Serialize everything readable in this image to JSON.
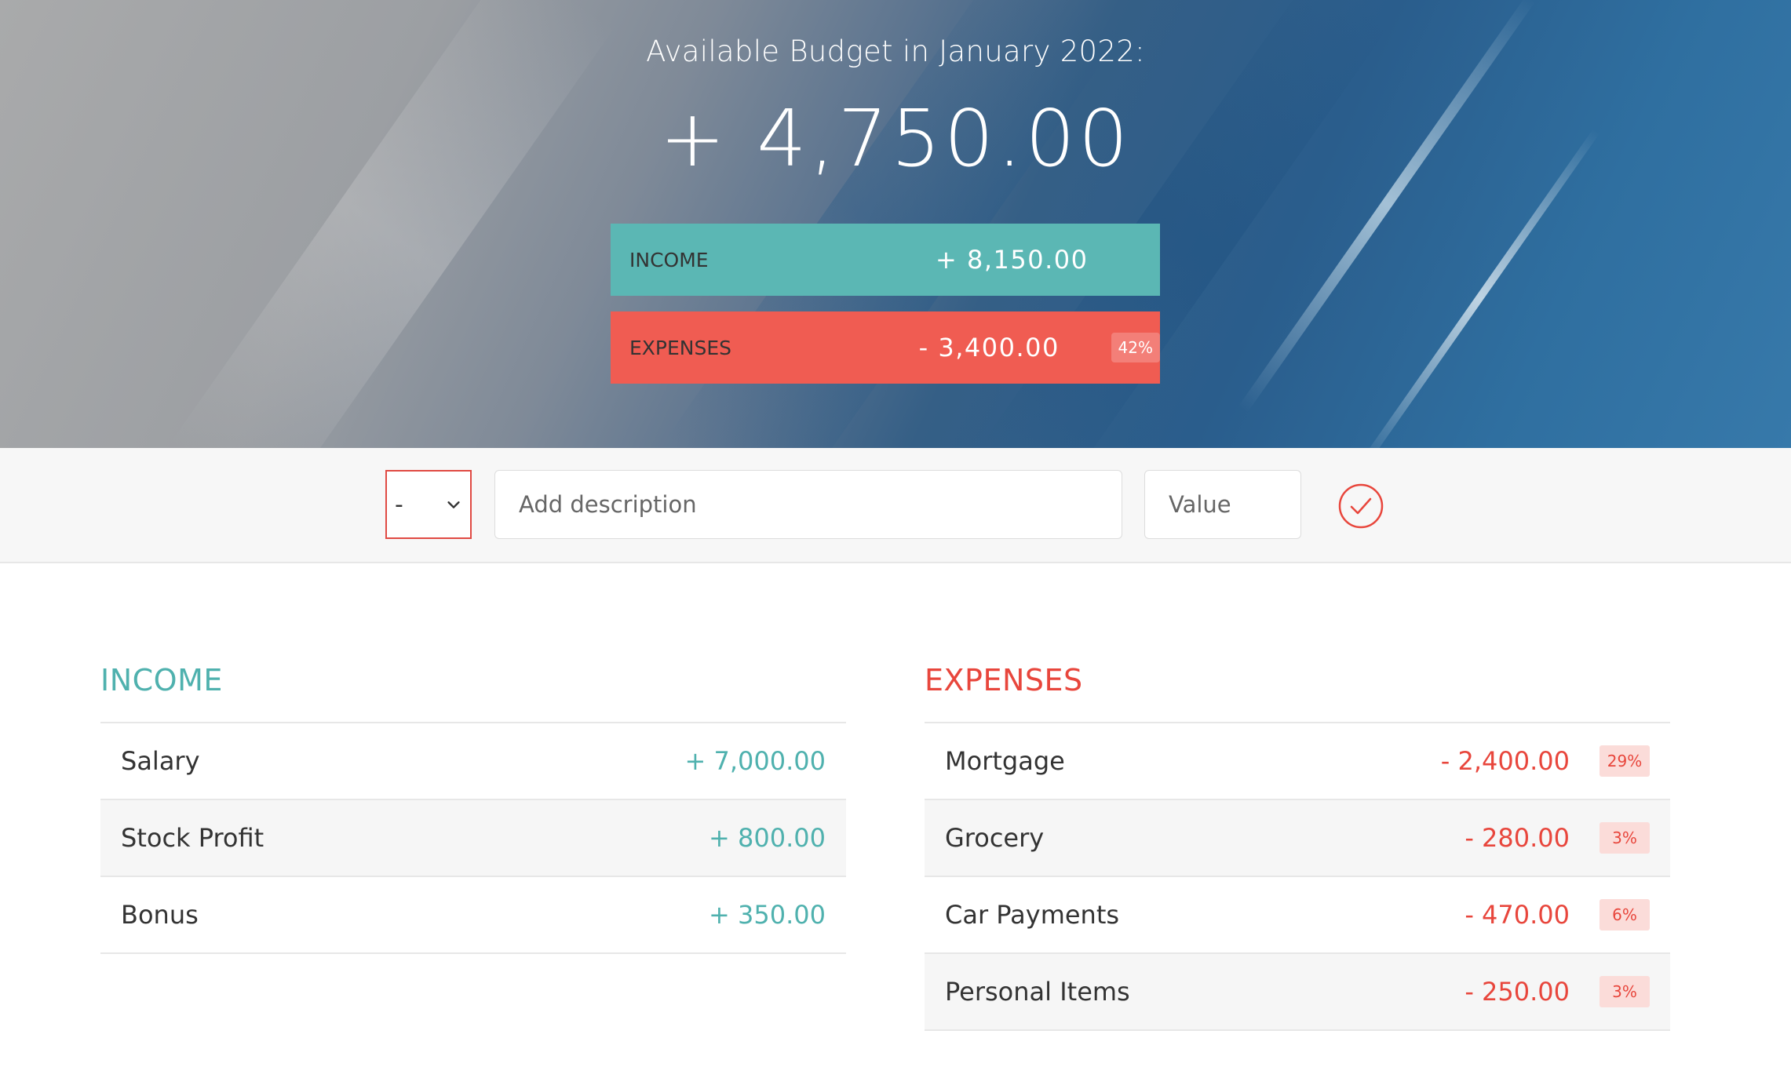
{
  "header": {
    "title": "Available Budget in January 2022:",
    "budget": "+ 4,750.00",
    "income_label": "INCOME",
    "income_value": "+ 8,150.00",
    "expenses_label": "EXPENSES",
    "expenses_value": "- 3,400.00",
    "expenses_percentage": "42%"
  },
  "add_form": {
    "type_selected": "-",
    "description_placeholder": "Add description",
    "value_placeholder": "Value",
    "submit_icon": "checkmark-circle-icon"
  },
  "income": {
    "title": "INCOME",
    "items": [
      {
        "description": "Salary",
        "value": "+ 7,000.00"
      },
      {
        "description": "Stock Profit",
        "value": "+ 800.00"
      },
      {
        "description": "Bonus",
        "value": "+ 350.00"
      }
    ]
  },
  "expenses": {
    "title": "EXPENSES",
    "items": [
      {
        "description": "Mortgage",
        "value": "- 2,400.00",
        "percentage": "29%"
      },
      {
        "description": "Grocery",
        "value": "- 280.00",
        "percentage": "3%"
      },
      {
        "description": "Car Payments",
        "value": "- 470.00",
        "percentage": "6%"
      },
      {
        "description": "Personal Items",
        "value": "- 250.00",
        "percentage": "3%"
      }
    ]
  },
  "colors": {
    "income": "#5bb7b4",
    "expenses": "#f05c52",
    "income_text": "#4fb1ae",
    "expenses_text": "#e8463c"
  }
}
